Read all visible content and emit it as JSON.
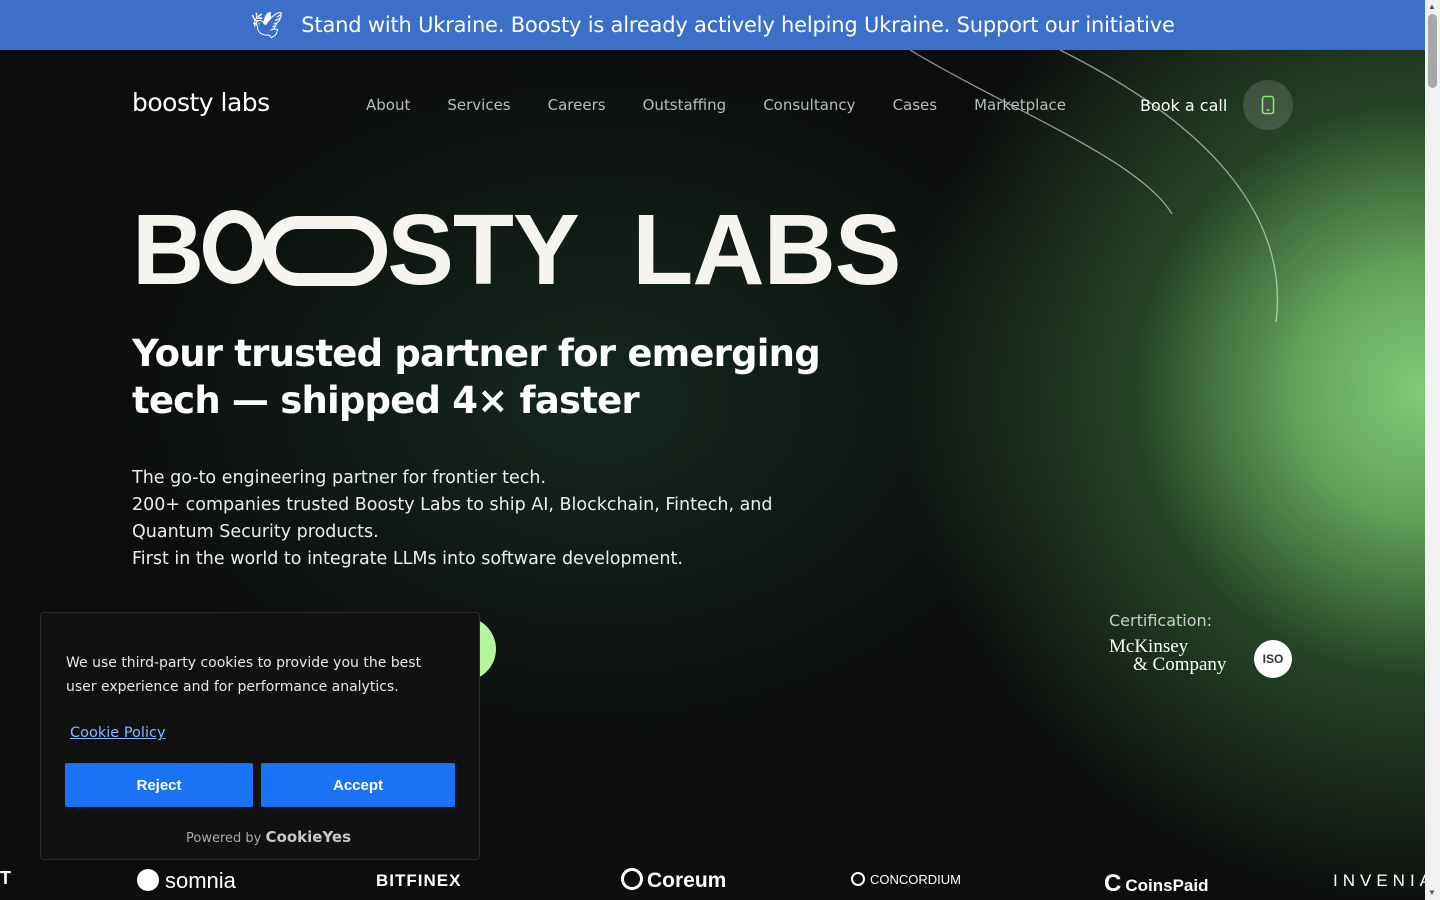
{
  "banner": {
    "text": "Stand with Ukraine. Boosty is already actively helping Ukraine. Support our initiative",
    "icon": "dove-icon",
    "background": "#3b6fc8"
  },
  "header": {
    "logo": "boosty labs",
    "nav": [
      "About",
      "Services",
      "Careers",
      "Outstaffing",
      "Consultancy",
      "Cases",
      "Marketplace"
    ],
    "book_call": "Book a call",
    "phone_icon": "phone-icon"
  },
  "hero": {
    "headline_part1": "B",
    "headline_part2": "STY",
    "headline_part3": "LABS",
    "tagline": "Your trusted partner for emerging tech — shipped 4× faster",
    "desc": [
      "The go-to engineering partner for frontier tech.",
      "200+ companies trusted Boosty Labs to ship AI, Blockchain, Fintech, and Quantum Security products.",
      "First in the world to integrate LLMs into software development."
    ],
    "accent": "#7fcf74"
  },
  "certification": {
    "label": "Certification:",
    "mckinsey_line1": "McKinsey",
    "mckinsey_line2": "& Company",
    "iso": "ISO"
  },
  "clients": [
    "T",
    "somnia",
    "BITFINEX",
    "Coreum",
    "CONCORDIUM",
    "CoinsPaid",
    "INVENIA"
  ],
  "cookie": {
    "message": "We use third-party cookies to provide you the best user experience and for performance analytics.",
    "policy_link": "Cookie Policy",
    "reject": "Reject",
    "accept": "Accept",
    "powered_by": "Powered by",
    "brand": "CookieYes",
    "button_color": "#1a73f5"
  }
}
